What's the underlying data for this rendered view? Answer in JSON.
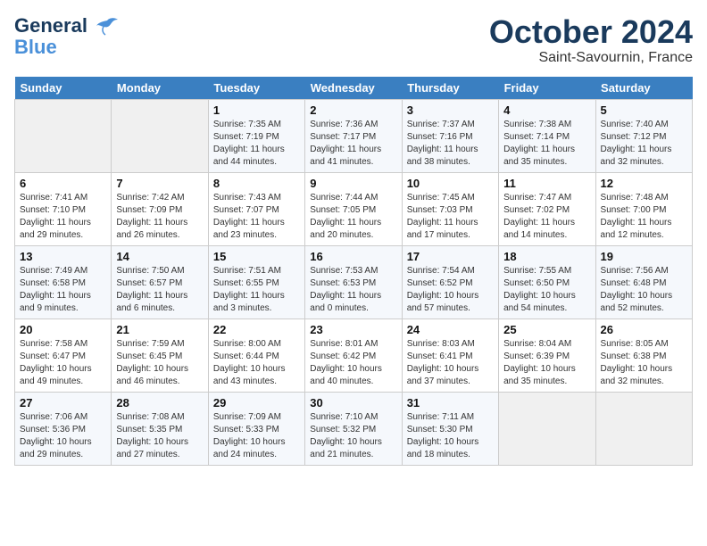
{
  "header": {
    "logo_general": "General",
    "logo_blue": "Blue",
    "title": "October 2024",
    "subtitle": "Saint-Savournin, France"
  },
  "weekdays": [
    "Sunday",
    "Monday",
    "Tuesday",
    "Wednesday",
    "Thursday",
    "Friday",
    "Saturday"
  ],
  "weeks": [
    [
      {
        "day": "",
        "info": ""
      },
      {
        "day": "",
        "info": ""
      },
      {
        "day": "1",
        "info": "Sunrise: 7:35 AM\nSunset: 7:19 PM\nDaylight: 11 hours and 44 minutes."
      },
      {
        "day": "2",
        "info": "Sunrise: 7:36 AM\nSunset: 7:17 PM\nDaylight: 11 hours and 41 minutes."
      },
      {
        "day": "3",
        "info": "Sunrise: 7:37 AM\nSunset: 7:16 PM\nDaylight: 11 hours and 38 minutes."
      },
      {
        "day": "4",
        "info": "Sunrise: 7:38 AM\nSunset: 7:14 PM\nDaylight: 11 hours and 35 minutes."
      },
      {
        "day": "5",
        "info": "Sunrise: 7:40 AM\nSunset: 7:12 PM\nDaylight: 11 hours and 32 minutes."
      }
    ],
    [
      {
        "day": "6",
        "info": "Sunrise: 7:41 AM\nSunset: 7:10 PM\nDaylight: 11 hours and 29 minutes."
      },
      {
        "day": "7",
        "info": "Sunrise: 7:42 AM\nSunset: 7:09 PM\nDaylight: 11 hours and 26 minutes."
      },
      {
        "day": "8",
        "info": "Sunrise: 7:43 AM\nSunset: 7:07 PM\nDaylight: 11 hours and 23 minutes."
      },
      {
        "day": "9",
        "info": "Sunrise: 7:44 AM\nSunset: 7:05 PM\nDaylight: 11 hours and 20 minutes."
      },
      {
        "day": "10",
        "info": "Sunrise: 7:45 AM\nSunset: 7:03 PM\nDaylight: 11 hours and 17 minutes."
      },
      {
        "day": "11",
        "info": "Sunrise: 7:47 AM\nSunset: 7:02 PM\nDaylight: 11 hours and 14 minutes."
      },
      {
        "day": "12",
        "info": "Sunrise: 7:48 AM\nSunset: 7:00 PM\nDaylight: 11 hours and 12 minutes."
      }
    ],
    [
      {
        "day": "13",
        "info": "Sunrise: 7:49 AM\nSunset: 6:58 PM\nDaylight: 11 hours and 9 minutes."
      },
      {
        "day": "14",
        "info": "Sunrise: 7:50 AM\nSunset: 6:57 PM\nDaylight: 11 hours and 6 minutes."
      },
      {
        "day": "15",
        "info": "Sunrise: 7:51 AM\nSunset: 6:55 PM\nDaylight: 11 hours and 3 minutes."
      },
      {
        "day": "16",
        "info": "Sunrise: 7:53 AM\nSunset: 6:53 PM\nDaylight: 11 hours and 0 minutes."
      },
      {
        "day": "17",
        "info": "Sunrise: 7:54 AM\nSunset: 6:52 PM\nDaylight: 10 hours and 57 minutes."
      },
      {
        "day": "18",
        "info": "Sunrise: 7:55 AM\nSunset: 6:50 PM\nDaylight: 10 hours and 54 minutes."
      },
      {
        "day": "19",
        "info": "Sunrise: 7:56 AM\nSunset: 6:48 PM\nDaylight: 10 hours and 52 minutes."
      }
    ],
    [
      {
        "day": "20",
        "info": "Sunrise: 7:58 AM\nSunset: 6:47 PM\nDaylight: 10 hours and 49 minutes."
      },
      {
        "day": "21",
        "info": "Sunrise: 7:59 AM\nSunset: 6:45 PM\nDaylight: 10 hours and 46 minutes."
      },
      {
        "day": "22",
        "info": "Sunrise: 8:00 AM\nSunset: 6:44 PM\nDaylight: 10 hours and 43 minutes."
      },
      {
        "day": "23",
        "info": "Sunrise: 8:01 AM\nSunset: 6:42 PM\nDaylight: 10 hours and 40 minutes."
      },
      {
        "day": "24",
        "info": "Sunrise: 8:03 AM\nSunset: 6:41 PM\nDaylight: 10 hours and 37 minutes."
      },
      {
        "day": "25",
        "info": "Sunrise: 8:04 AM\nSunset: 6:39 PM\nDaylight: 10 hours and 35 minutes."
      },
      {
        "day": "26",
        "info": "Sunrise: 8:05 AM\nSunset: 6:38 PM\nDaylight: 10 hours and 32 minutes."
      }
    ],
    [
      {
        "day": "27",
        "info": "Sunrise: 7:06 AM\nSunset: 5:36 PM\nDaylight: 10 hours and 29 minutes."
      },
      {
        "day": "28",
        "info": "Sunrise: 7:08 AM\nSunset: 5:35 PM\nDaylight: 10 hours and 27 minutes."
      },
      {
        "day": "29",
        "info": "Sunrise: 7:09 AM\nSunset: 5:33 PM\nDaylight: 10 hours and 24 minutes."
      },
      {
        "day": "30",
        "info": "Sunrise: 7:10 AM\nSunset: 5:32 PM\nDaylight: 10 hours and 21 minutes."
      },
      {
        "day": "31",
        "info": "Sunrise: 7:11 AM\nSunset: 5:30 PM\nDaylight: 10 hours and 18 minutes."
      },
      {
        "day": "",
        "info": ""
      },
      {
        "day": "",
        "info": ""
      }
    ]
  ]
}
